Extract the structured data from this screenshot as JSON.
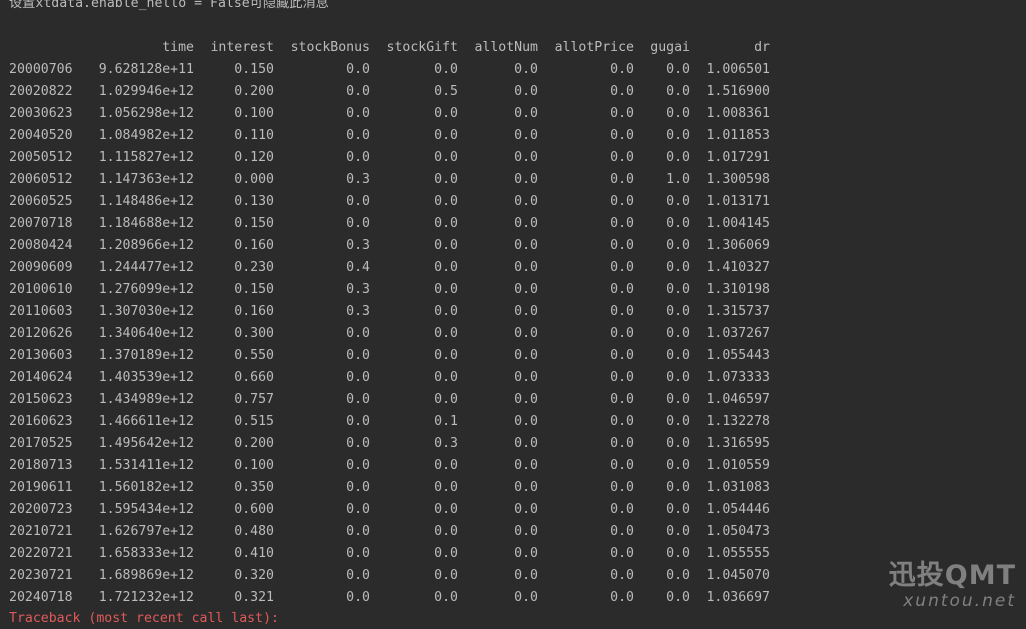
{
  "console": {
    "hint": "设置xtdata.enable_hello = False可隐藏此消息",
    "traceback": "Traceback (most recent call last):"
  },
  "table": {
    "columns": [
      "time",
      "interest",
      "stockBonus",
      "stockGift",
      "allotNum",
      "allotPrice",
      "gugai",
      "dr"
    ],
    "rows": [
      {
        "index": "20000706",
        "cells": [
          "9.628128e+11",
          "0.150",
          "0.0",
          "0.0",
          "0.0",
          "0.0",
          "0.0",
          "1.006501"
        ]
      },
      {
        "index": "20020822",
        "cells": [
          "1.029946e+12",
          "0.200",
          "0.0",
          "0.5",
          "0.0",
          "0.0",
          "0.0",
          "1.516900"
        ]
      },
      {
        "index": "20030623",
        "cells": [
          "1.056298e+12",
          "0.100",
          "0.0",
          "0.0",
          "0.0",
          "0.0",
          "0.0",
          "1.008361"
        ]
      },
      {
        "index": "20040520",
        "cells": [
          "1.084982e+12",
          "0.110",
          "0.0",
          "0.0",
          "0.0",
          "0.0",
          "0.0",
          "1.011853"
        ]
      },
      {
        "index": "20050512",
        "cells": [
          "1.115827e+12",
          "0.120",
          "0.0",
          "0.0",
          "0.0",
          "0.0",
          "0.0",
          "1.017291"
        ]
      },
      {
        "index": "20060512",
        "cells": [
          "1.147363e+12",
          "0.000",
          "0.3",
          "0.0",
          "0.0",
          "0.0",
          "1.0",
          "1.300598"
        ]
      },
      {
        "index": "20060525",
        "cells": [
          "1.148486e+12",
          "0.130",
          "0.0",
          "0.0",
          "0.0",
          "0.0",
          "0.0",
          "1.013171"
        ]
      },
      {
        "index": "20070718",
        "cells": [
          "1.184688e+12",
          "0.150",
          "0.0",
          "0.0",
          "0.0",
          "0.0",
          "0.0",
          "1.004145"
        ]
      },
      {
        "index": "20080424",
        "cells": [
          "1.208966e+12",
          "0.160",
          "0.3",
          "0.0",
          "0.0",
          "0.0",
          "0.0",
          "1.306069"
        ]
      },
      {
        "index": "20090609",
        "cells": [
          "1.244477e+12",
          "0.230",
          "0.4",
          "0.0",
          "0.0",
          "0.0",
          "0.0",
          "1.410327"
        ]
      },
      {
        "index": "20100610",
        "cells": [
          "1.276099e+12",
          "0.150",
          "0.3",
          "0.0",
          "0.0",
          "0.0",
          "0.0",
          "1.310198"
        ]
      },
      {
        "index": "20110603",
        "cells": [
          "1.307030e+12",
          "0.160",
          "0.3",
          "0.0",
          "0.0",
          "0.0",
          "0.0",
          "1.315737"
        ]
      },
      {
        "index": "20120626",
        "cells": [
          "1.340640e+12",
          "0.300",
          "0.0",
          "0.0",
          "0.0",
          "0.0",
          "0.0",
          "1.037267"
        ]
      },
      {
        "index": "20130603",
        "cells": [
          "1.370189e+12",
          "0.550",
          "0.0",
          "0.0",
          "0.0",
          "0.0",
          "0.0",
          "1.055443"
        ]
      },
      {
        "index": "20140624",
        "cells": [
          "1.403539e+12",
          "0.660",
          "0.0",
          "0.0",
          "0.0",
          "0.0",
          "0.0",
          "1.073333"
        ]
      },
      {
        "index": "20150623",
        "cells": [
          "1.434989e+12",
          "0.757",
          "0.0",
          "0.0",
          "0.0",
          "0.0",
          "0.0",
          "1.046597"
        ]
      },
      {
        "index": "20160623",
        "cells": [
          "1.466611e+12",
          "0.515",
          "0.0",
          "0.1",
          "0.0",
          "0.0",
          "0.0",
          "1.132278"
        ]
      },
      {
        "index": "20170525",
        "cells": [
          "1.495642e+12",
          "0.200",
          "0.0",
          "0.3",
          "0.0",
          "0.0",
          "0.0",
          "1.316595"
        ]
      },
      {
        "index": "20180713",
        "cells": [
          "1.531411e+12",
          "0.100",
          "0.0",
          "0.0",
          "0.0",
          "0.0",
          "0.0",
          "1.010559"
        ]
      },
      {
        "index": "20190611",
        "cells": [
          "1.560182e+12",
          "0.350",
          "0.0",
          "0.0",
          "0.0",
          "0.0",
          "0.0",
          "1.031083"
        ]
      },
      {
        "index": "20200723",
        "cells": [
          "1.595434e+12",
          "0.600",
          "0.0",
          "0.0",
          "0.0",
          "0.0",
          "0.0",
          "1.054446"
        ]
      },
      {
        "index": "20210721",
        "cells": [
          "1.626797e+12",
          "0.480",
          "0.0",
          "0.0",
          "0.0",
          "0.0",
          "0.0",
          "1.050473"
        ]
      },
      {
        "index": "20220721",
        "cells": [
          "1.658333e+12",
          "0.410",
          "0.0",
          "0.0",
          "0.0",
          "0.0",
          "0.0",
          "1.055555"
        ]
      },
      {
        "index": "20230721",
        "cells": [
          "1.689869e+12",
          "0.320",
          "0.0",
          "0.0",
          "0.0",
          "0.0",
          "0.0",
          "1.045070"
        ]
      },
      {
        "index": "20240718",
        "cells": [
          "1.721232e+12",
          "0.321",
          "0.0",
          "0.0",
          "0.0",
          "0.0",
          "0.0",
          "1.036697"
        ]
      }
    ]
  },
  "watermark": {
    "brand": "迅投QMT",
    "url": "xuntou.net"
  },
  "colors": {
    "background": "#2b2b2b",
    "text": "#bbbbbb",
    "error": "#e05a5a",
    "watermark": "#8f8f8f"
  }
}
